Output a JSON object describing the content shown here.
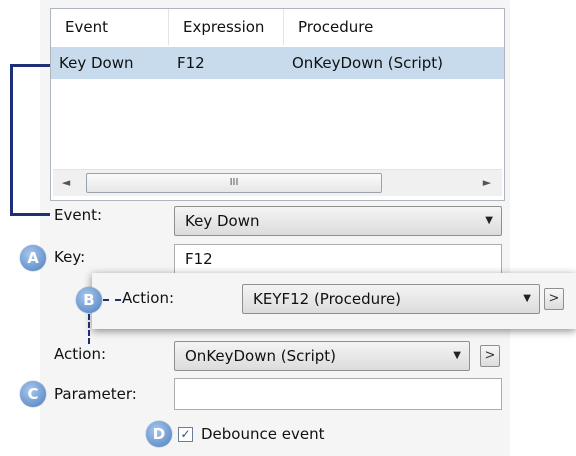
{
  "list": {
    "columns": [
      "Event",
      "Expression",
      "Procedure"
    ],
    "rows": [
      {
        "event": "Key Down",
        "expression": "F12",
        "procedure": "OnKeyDown (Script)"
      }
    ],
    "scroll_thumb_glyph": "III",
    "scroll_left_glyph": "◄",
    "scroll_right_glyph": "►"
  },
  "form": {
    "event_label": "Event:",
    "event_value": "Key Down",
    "key_label": "Key:",
    "key_value": "F12",
    "action_label": "Action:",
    "action_value": "OnKeyDown (Script)",
    "parameter_label": "Parameter:",
    "parameter_value": "",
    "debounce_label": "Debounce event",
    "debounce_checked": true,
    "check_glyph": "✓",
    "dropdown_glyph": "▼",
    "browse_glyph": ">"
  },
  "overlay": {
    "action_label": "Action:",
    "action_value": "KEYF12 (Procedure)"
  },
  "callouts": [
    "A",
    "B",
    "C",
    "D"
  ],
  "colors": {
    "selection": "#c8dbec",
    "callout": "#4b7fc0",
    "bracket": "#1e2f78"
  }
}
